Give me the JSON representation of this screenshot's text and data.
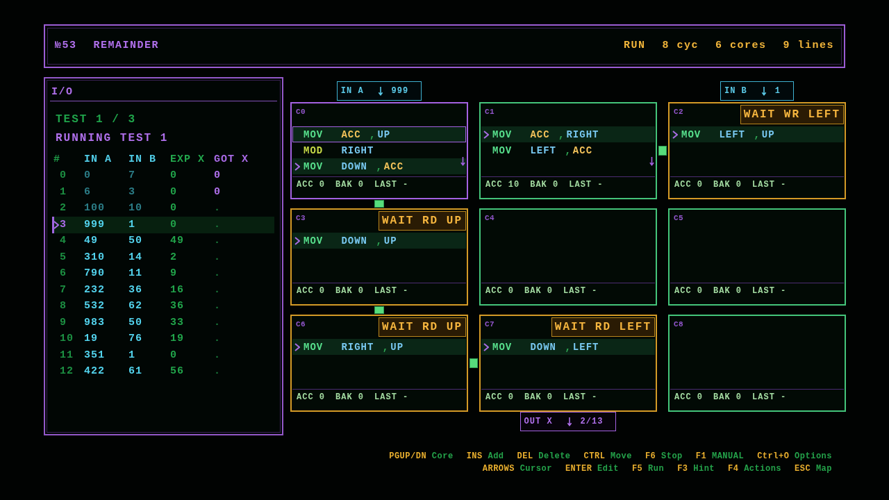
{
  "header": {
    "puzzle_id": "№53",
    "title": "REMAINDER",
    "stats": [
      "RUN",
      "8 cyc",
      "6 cores",
      "9 lines"
    ]
  },
  "io_panel": {
    "title": "I/O",
    "status_lines": [
      {
        "text": "TEST 1 / 3",
        "color": "#1fa34a"
      },
      {
        "text": "RUNNING TEST 1",
        "color": "#b070ec"
      }
    ],
    "columns": [
      {
        "label": "#",
        "kind": "index"
      },
      {
        "label": "IN A",
        "kind": "input"
      },
      {
        "label": "IN B",
        "kind": "input"
      },
      {
        "label": "EXP X",
        "kind": "expected"
      },
      {
        "label": "GOT X",
        "kind": "output"
      }
    ],
    "rows": [
      {
        "cells": [
          "0",
          "0",
          "7",
          "0",
          "0"
        ],
        "consumed": true,
        "received": true,
        "selected": false
      },
      {
        "cells": [
          "1",
          "6",
          "3",
          "0",
          "0"
        ],
        "consumed": true,
        "received": true,
        "selected": false
      },
      {
        "cells": [
          "2",
          "100",
          "10",
          "0",
          "."
        ],
        "consumed": true,
        "received": false,
        "selected": false
      },
      {
        "cells": [
          "3",
          "999",
          "1",
          "0",
          "."
        ],
        "consumed": false,
        "received": false,
        "selected": true
      },
      {
        "cells": [
          "4",
          "49",
          "50",
          "49",
          "."
        ],
        "consumed": false,
        "received": false,
        "selected": false
      },
      {
        "cells": [
          "5",
          "310",
          "14",
          "2",
          "."
        ],
        "consumed": false,
        "received": false,
        "selected": false
      },
      {
        "cells": [
          "6",
          "790",
          "11",
          "9",
          "."
        ],
        "consumed": false,
        "received": false,
        "selected": false
      },
      {
        "cells": [
          "7",
          "232",
          "36",
          "16",
          "."
        ],
        "consumed": false,
        "received": false,
        "selected": false
      },
      {
        "cells": [
          "8",
          "532",
          "62",
          "36",
          "."
        ],
        "consumed": false,
        "received": false,
        "selected": false
      },
      {
        "cells": [
          "9",
          "983",
          "50",
          "33",
          "."
        ],
        "consumed": false,
        "received": false,
        "selected": false
      },
      {
        "cells": [
          "10",
          "19",
          "76",
          "19",
          "."
        ],
        "consumed": false,
        "received": false,
        "selected": false
      },
      {
        "cells": [
          "11",
          "351",
          "1",
          "0",
          "."
        ],
        "consumed": false,
        "received": false,
        "selected": false
      },
      {
        "cells": [
          "12",
          "422",
          "61",
          "56",
          "."
        ],
        "consumed": false,
        "received": false,
        "selected": false
      }
    ]
  },
  "core_rows": [
    {
      "cores": [
        {
          "label": "C0",
          "selected": true,
          "waiting": false,
          "port_above": {
            "kind": "input",
            "label": "IN A",
            "value": "999"
          },
          "lines": [
            {
              "op": "MOV",
              "arg1": {
                "text": "ACC",
                "kind": "register"
              },
              "separator": ",",
              "arg2": {
                "text": "UP",
                "kind": "port"
              },
              "valid": true,
              "current": false,
              "selected": true
            },
            {
              "op": "MOD",
              "arg1": {
                "text": "RIGHT",
                "kind": "port"
              },
              "valid": false,
              "current": false,
              "selected": false
            },
            {
              "op": "MOV",
              "arg1": {
                "text": "DOWN",
                "kind": "port"
              },
              "separator": ",",
              "arg2": {
                "text": "ACC",
                "kind": "register"
              },
              "valid": true,
              "current": true,
              "selected": false
            }
          ],
          "more_below": true,
          "link_down": true,
          "registers": [
            "ACC 0",
            "BAK 0",
            "LAST -"
          ]
        },
        {
          "label": "C1",
          "selected": false,
          "waiting": false,
          "lines": [
            {
              "op": "MOV",
              "arg1": {
                "text": "ACC",
                "kind": "register"
              },
              "separator": ",",
              "arg2": {
                "text": "RIGHT",
                "kind": "port"
              },
              "valid": true,
              "current": true,
              "selected": false
            },
            {
              "op": "MOV",
              "arg1": {
                "text": "LEFT",
                "kind": "port"
              },
              "separator": ",",
              "arg2": {
                "text": "ACC",
                "kind": "register"
              },
              "valid": true,
              "current": false,
              "selected": false
            }
          ],
          "more_below": true,
          "link_right": true,
          "registers": [
            "ACC 10",
            "BAK 0",
            "LAST -"
          ]
        },
        {
          "label": "C2",
          "selected": false,
          "waiting": true,
          "badge": "WAIT WR LEFT",
          "port_above": {
            "kind": "input",
            "label": "IN B",
            "value": "1"
          },
          "lines": [
            {
              "op": "MOV",
              "arg1": {
                "text": "LEFT",
                "kind": "port"
              },
              "separator": ",",
              "arg2": {
                "text": "UP",
                "kind": "port"
              },
              "valid": true,
              "current": true,
              "selected": false
            }
          ],
          "registers": [
            "ACC 0",
            "BAK 0",
            "LAST -"
          ]
        }
      ]
    },
    {
      "cores": [
        {
          "label": "C3",
          "selected": false,
          "waiting": true,
          "badge": "WAIT RD UP",
          "lines": [
            {
              "op": "MOV",
              "arg1": {
                "text": "DOWN",
                "kind": "port"
              },
              "separator": ",",
              "arg2": {
                "text": "UP",
                "kind": "port"
              },
              "valid": true,
              "current": true,
              "selected": false
            }
          ],
          "link_down": true,
          "registers": [
            "ACC 0",
            "BAK 0",
            "LAST -"
          ]
        },
        {
          "label": "C4",
          "selected": false,
          "waiting": false,
          "registers": [
            "ACC 0",
            "BAK 0",
            "LAST -"
          ]
        },
        {
          "label": "C5",
          "selected": false,
          "waiting": false,
          "registers": [
            "ACC 0",
            "BAK 0",
            "LAST -"
          ]
        }
      ]
    },
    {
      "cores": [
        {
          "label": "C6",
          "selected": false,
          "waiting": true,
          "badge": "WAIT RD UP",
          "lines": [
            {
              "op": "MOV",
              "arg1": {
                "text": "RIGHT",
                "kind": "port"
              },
              "separator": ",",
              "arg2": {
                "text": "UP",
                "kind": "port"
              },
              "valid": true,
              "current": true,
              "selected": false
            }
          ],
          "link_right": true,
          "registers": [
            "ACC 0",
            "BAK 0",
            "LAST -"
          ]
        },
        {
          "label": "C7",
          "selected": false,
          "waiting": true,
          "badge": "WAIT RD LEFT",
          "port_below": {
            "kind": "output",
            "label": "OUT X",
            "value": "2/13"
          },
          "lines": [
            {
              "op": "MOV",
              "arg1": {
                "text": "DOWN",
                "kind": "port"
              },
              "separator": ",",
              "arg2": {
                "text": "LEFT",
                "kind": "port"
              },
              "valid": true,
              "current": true,
              "selected": false
            }
          ],
          "registers": [
            "ACC 0",
            "BAK 0",
            "LAST -"
          ]
        },
        {
          "label": "C8",
          "selected": false,
          "waiting": false,
          "registers": [
            "ACC 0",
            "BAK 0",
            "LAST -"
          ]
        }
      ]
    }
  ],
  "key_hints": [
    {
      "items": [
        {
          "key": "PGUP/DN",
          "action": "Core"
        },
        {
          "key": "INS",
          "action": "Add"
        },
        {
          "key": "DEL",
          "action": "Delete"
        },
        {
          "key": "CTRL",
          "action": "Move"
        },
        {
          "key": "F6",
          "action": "Stop"
        },
        {
          "key": "F1",
          "action": "MANUAL"
        },
        {
          "key": "Ctrl+O",
          "action": "Options"
        }
      ]
    },
    {
      "items": [
        {
          "key": "ARROWS",
          "action": "Cursor"
        },
        {
          "key": "ENTER",
          "action": "Edit"
        },
        {
          "key": "F5",
          "action": "Run"
        },
        {
          "key": "F3",
          "action": "Hint"
        },
        {
          "key": "F4",
          "action": "Actions"
        },
        {
          "key": "ESC",
          "action": "Map"
        }
      ]
    }
  ]
}
